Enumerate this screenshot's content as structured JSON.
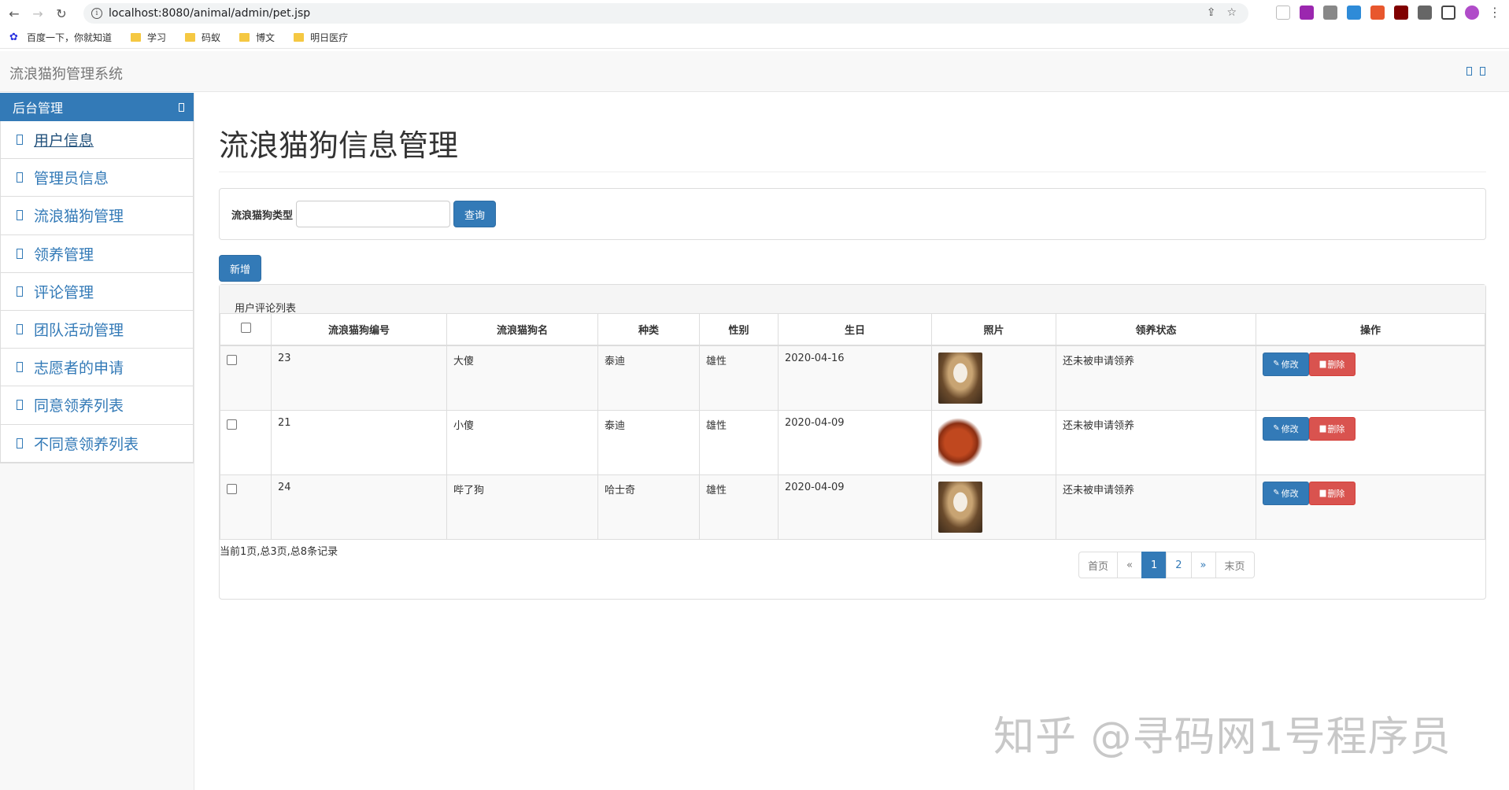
{
  "browser": {
    "url": "localhost:8080/animal/admin/pet.jsp",
    "bookmarks": [
      "百度一下，你就知道",
      "学习",
      "码蚁",
      "博文",
      "明日医疗"
    ]
  },
  "app": {
    "brand": "流浪猫狗管理系统"
  },
  "sidebar": {
    "heading": "后台管理",
    "items": [
      {
        "label": "用户信息"
      },
      {
        "label": "管理员信息"
      },
      {
        "label": "流浪猫狗管理"
      },
      {
        "label": "领养管理"
      },
      {
        "label": "评论管理"
      },
      {
        "label": "团队活动管理"
      },
      {
        "label": "志愿者的申请"
      },
      {
        "label": "同意领养列表"
      },
      {
        "label": "不同意领养列表"
      }
    ]
  },
  "main": {
    "title": "流浪猫狗信息管理",
    "search": {
      "label": "流浪猫狗类型",
      "value": "",
      "button": "查询"
    },
    "add_button": "新增",
    "list_heading": "用户评论列表",
    "columns": [
      "流浪猫狗编号",
      "流浪猫狗名",
      "种类",
      "性别",
      "生日",
      "照片",
      "领养状态",
      "操作"
    ],
    "rows": [
      {
        "id": "23",
        "name": "大傻",
        "kind": "泰迪",
        "sex": "雄性",
        "birthday": "2020-04-16",
        "photo": "husky",
        "status": "还未被申请领养"
      },
      {
        "id": "21",
        "name": "小傻",
        "kind": "泰迪",
        "sex": "雄性",
        "birthday": "2020-04-09",
        "photo": "poodle",
        "status": "还未被申请领养"
      },
      {
        "id": "24",
        "name": "哔了狗",
        "kind": "哈士奇",
        "sex": "雄性",
        "birthday": "2020-04-09",
        "photo": "husky",
        "status": "还未被申请领养"
      }
    ],
    "edit_label": "修改",
    "delete_label": "删除",
    "page_info": "当前1页,总3页,总8条记录",
    "pagination": {
      "first": "首页",
      "prev": "«",
      "pages": [
        "1",
        "2"
      ],
      "next": "»",
      "last": "末页"
    }
  },
  "watermark": "知乎 @寻码网1号程序员"
}
